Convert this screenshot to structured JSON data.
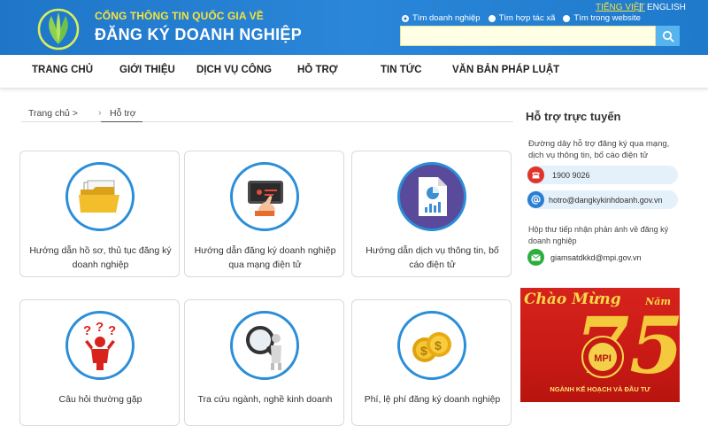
{
  "header": {
    "site_subtitle": "CỔNG THÔNG TIN QUỐC GIA VỀ",
    "site_title": "ĐĂNG KÝ DOANH NGHIỆP",
    "lang_vn": "TIẾNG VIỆT",
    "lang_sep": "|",
    "lang_en": "ENGLISH",
    "search_options": [
      {
        "label": "Tìm doanh nghiệp",
        "selected": true
      },
      {
        "label": "Tìm hợp tác xã",
        "selected": false
      },
      {
        "label": "Tìm trong website",
        "selected": false
      }
    ],
    "search_value": ""
  },
  "nav": [
    "TRANG CHỦ",
    "GIỚI THIỆU",
    "DỊCH VỤ CÔNG",
    "HỖ TRỢ",
    "TIN TỨC",
    "VĂN BẢN PHÁP LUẬT"
  ],
  "breadcrumb": {
    "home": "Trang chủ >",
    "sep": "›",
    "current": "Hỗ trợ"
  },
  "cards": [
    {
      "label": "Hướng dẫn hồ sơ, thủ tục đăng ký doanh nghiệp",
      "icon": "folder-icon"
    },
    {
      "label": "Hướng dẫn đăng ký doanh nghiệp qua mạng điện tử",
      "icon": "tablet-touch-icon"
    },
    {
      "label": "Hướng dẫn dịch vụ thông tin, bố cáo điện tử",
      "icon": "report-chart-icon"
    },
    {
      "label": "Câu hỏi thường gặp",
      "icon": "question-person-icon"
    },
    {
      "label": "Tra cứu ngành, nghề kinh doanh",
      "icon": "magnifier-person-icon"
    },
    {
      "label": "Phí, lệ phí đăng ký doanh nghiệp",
      "icon": "coins-icon"
    }
  ],
  "sidebar": {
    "title": "Hỗ trợ trực tuyến",
    "hotline_desc_1": "Đường dây hỗ trợ đăng ký qua mạng,",
    "hotline_desc_2": "dịch vụ thông tin, bố cáo điện tử",
    "phone": "1900 9026",
    "email": "hotro@dangkykinhdoanh.gov.vn",
    "feedback_desc_1": "Hộp thư tiếp nhận phản ánh về đăng ký",
    "feedback_desc_2": "doanh nghiệp",
    "feedback_email": "giamsatdkkd@mpi.gov.vn",
    "banner_title": "Chào Mừng",
    "banner_big": "75",
    "banner_year": "Năm",
    "banner_seal": "MPI",
    "banner_org": "NGÀNH KẾ HOẠCH VÀ ĐẦU TƯ"
  },
  "colors": {
    "header_blue": "#1f76c9",
    "accent_yellow": "#f7e23a",
    "card_ring": "#2a8ed8",
    "banner_red": "#d6221c"
  }
}
